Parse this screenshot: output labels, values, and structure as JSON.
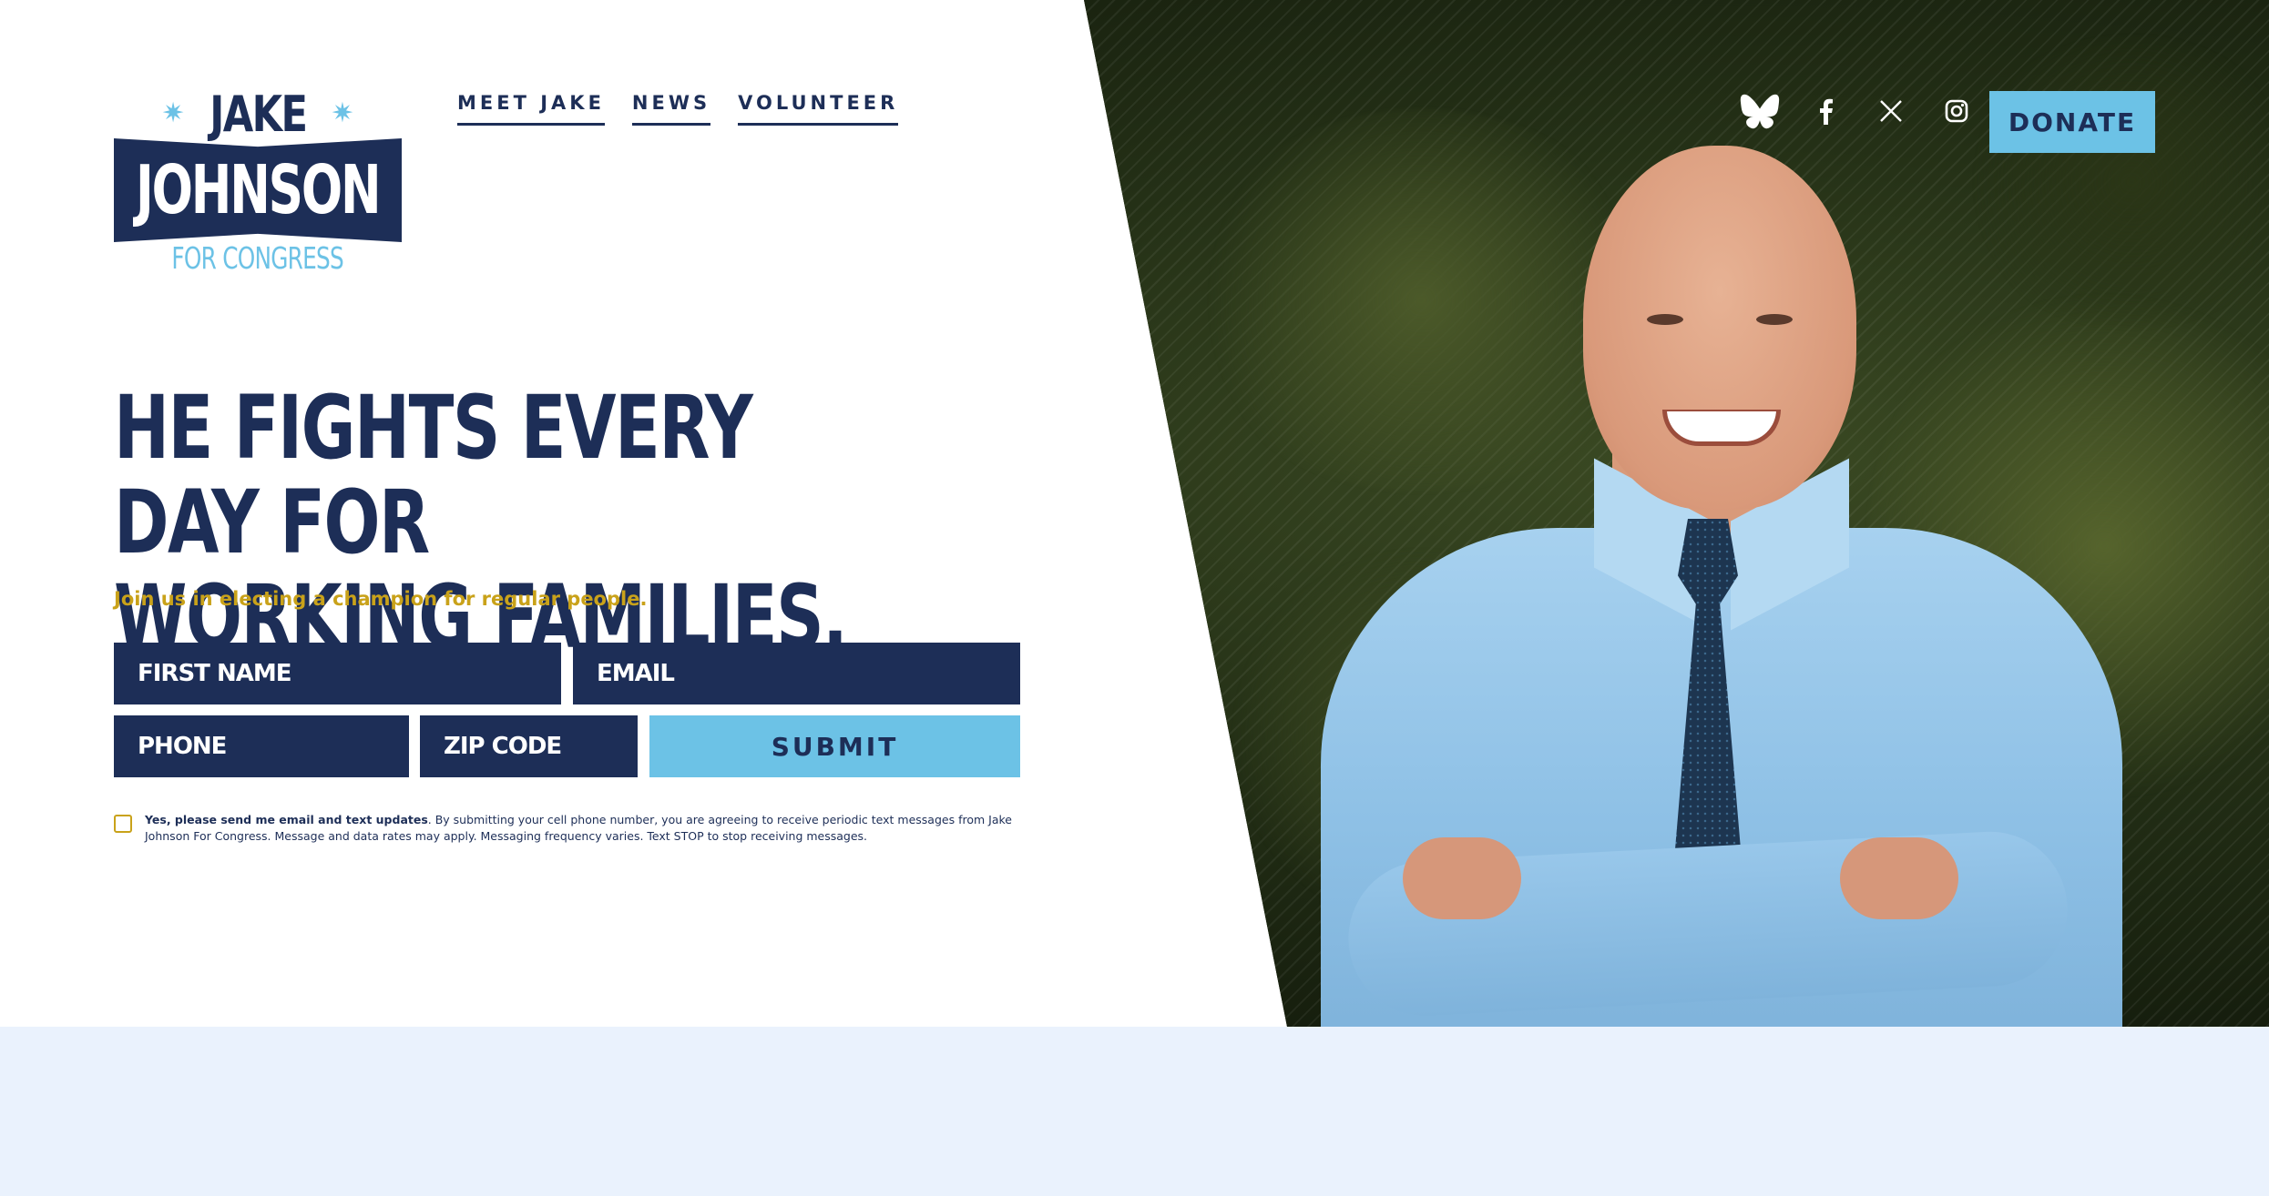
{
  "logo": {
    "top": "JAKE",
    "name": "JOHNSON",
    "subtitle": "FOR CONGRESS",
    "star_glyph": "✷"
  },
  "nav": {
    "items": [
      {
        "label": "MEET JAKE"
      },
      {
        "label": "NEWS"
      },
      {
        "label": "VOLUNTEER"
      }
    ]
  },
  "social": {
    "icons": [
      "bluesky-icon",
      "facebook-icon",
      "x-icon",
      "instagram-icon"
    ]
  },
  "donate": {
    "label": "DONATE"
  },
  "hero": {
    "headline_line1": "HE FIGHTS EVERY DAY FOR",
    "headline_line2": "WORKING FAMILIES.",
    "subhead": "Join us in electing a champion for regular people."
  },
  "form": {
    "first_name_placeholder": "FIRST NAME",
    "email_placeholder": "EMAIL",
    "phone_placeholder": "PHONE",
    "zip_placeholder": "ZIP CODE",
    "submit_label": "SUBMIT",
    "consent_bold": "Yes, please send me email and text updates",
    "consent_text": ". By submitting your cell phone number, you are agreeing to receive periodic text messages from Jake Johnson For Congress. Message and data rates may apply. Messaging frequency varies. Text STOP to stop receiving messages.",
    "consent_checked": false
  },
  "colors": {
    "navy": "#1d2e57",
    "sky": "#6cc2e6",
    "gold": "#c9a21a",
    "band": "#eaf2fd"
  }
}
